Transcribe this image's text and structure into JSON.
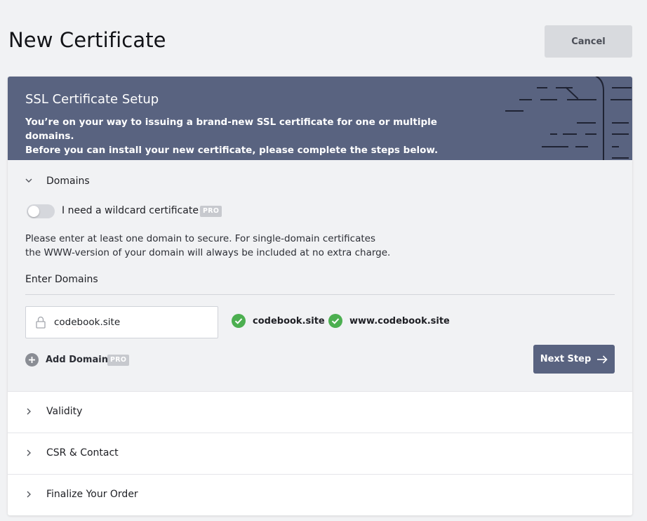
{
  "page": {
    "title": "New Certificate",
    "cancel_label": "Cancel"
  },
  "banner": {
    "title": "SSL Certificate Setup",
    "description_line1": "You’re on your way to issuing a brand-new SSL certificate for one or multiple domains.",
    "description_line2": "Before you can install your new certificate, please complete the steps below."
  },
  "domains_section": {
    "label": "Domains",
    "chevron": "chevron-down-icon",
    "wildcard": {
      "label": "I need a wildcard certificate",
      "enabled": false,
      "badge": "PRO"
    },
    "help_line1": "Please enter at least one domain to secure. For single-domain certificates",
    "help_line2": "the WWW-version of your domain will always be included at no extra charge.",
    "enter_label": "Enter Domains",
    "input_value": "codebook.site",
    "validated": [
      {
        "domain": "codebook.site",
        "icon": "check-circle-icon"
      },
      {
        "domain": "www.codebook.site",
        "icon": "check-circle-icon"
      }
    ],
    "add_domain": {
      "label": "Add Domain",
      "badge": "PRO"
    },
    "next_label": "Next Step"
  },
  "steps": [
    {
      "label": "Validity",
      "chevron": "chevron-right-icon"
    },
    {
      "label": "CSR & Contact",
      "chevron": "chevron-right-icon"
    },
    {
      "label": "Finalize Your Order",
      "chevron": "chevron-right-icon"
    }
  ],
  "colors": {
    "banner": "#596380",
    "primary_button": "#596380",
    "success": "#4caf50",
    "background": "#f1f2f4"
  }
}
